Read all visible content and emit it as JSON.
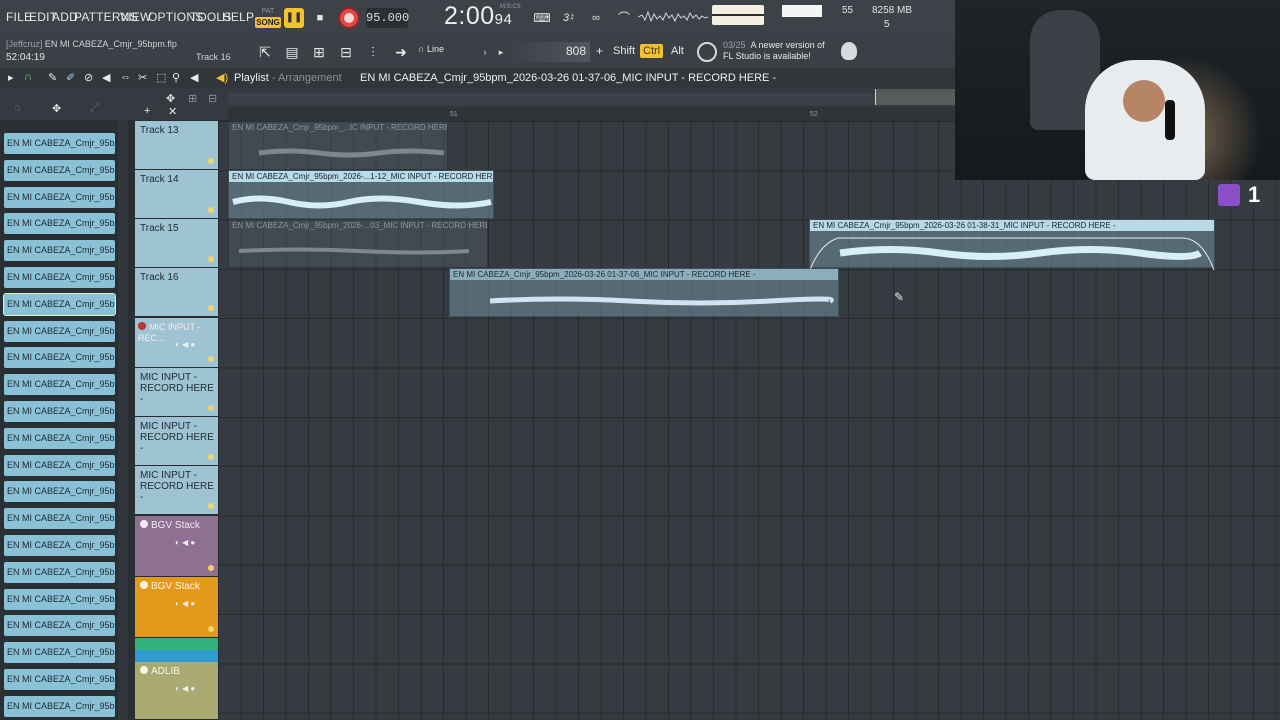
{
  "menu": [
    "FILE",
    "EDIT",
    "ADD",
    "PATTERNS",
    "VIEW",
    "OPTIONS",
    "TOOLS",
    "HELP"
  ],
  "mode": {
    "pat": "PAT",
    "song": "SONG"
  },
  "transport": {
    "tempo": "95.000",
    "time_main": "2:00",
    "time_frac": "94",
    "time_unit": "M:S:CS"
  },
  "monitor": {
    "cpu": "55",
    "memory": "8258 MB",
    "polyphony": "5"
  },
  "session": {
    "user": "[Jeffcruz]",
    "project_file": "EN MI CABEZA_Cmjr_95bpm.flp",
    "clock": "52:04:19",
    "track_label": "Track 16"
  },
  "toolbar": {
    "snap": "Line",
    "pattern_number": "808",
    "plus": "+",
    "shift": "Shift",
    "ctrl": "Ctrl",
    "alt": "Alt"
  },
  "notice": {
    "date": "03/25",
    "line1": "A newer version of",
    "line2": "FL Studio is available!"
  },
  "playlist": {
    "title": "Playlist",
    "section": "Arrangement",
    "current": "EN MI CABEZA_Cmjr_95bpm_2026-03-26 01-37-06_MIC INPUT - RECORD HERE -"
  },
  "ruler": {
    "mark1": "51",
    "mark2": "52"
  },
  "channels": [
    "EN MI CABEZA_Cmjr_95bp...",
    "EN MI CABEZA_Cmjr_95bp...",
    "EN MI CABEZA_Cmjr_95bp...",
    "EN MI CABEZA_Cmjr_95bp...",
    "EN MI CABEZA_Cmjr_95bp...",
    "EN MI CABEZA_Cmjr_95bp...",
    "EN MI CABEZA_Cmjr_95bp...",
    "EN MI CABEZA_Cmjr_95bp...",
    "EN MI CABEZA_Cmjr_95bp...",
    "EN MI CABEZA_Cmjr_95bp...",
    "EN MI CABEZA_Cmjr_95bp...",
    "EN MI CABEZA_Cmjr_95bp...",
    "EN MI CABEZA_Cmjr_95bp...",
    "EN MI CABEZA_Cmjr_95bp...",
    "EN MI CABEZA_Cmjr_95bp...",
    "EN MI CABEZA_Cmjr_95bp...",
    "EN MI CABEZA_Cmjr_95bp...",
    "EN MI CABEZA_Cmjr_95bp...",
    "EN MI CABEZA_Cmjr_95bp...",
    "EN MI CABEZA_Cmjr_95bp...",
    "EN MI CABEZA_Cmjr_95bp...",
    "EN MI CABEZA_Cmjr_95bp..."
  ],
  "tracks": [
    {
      "name": "Track 13"
    },
    {
      "name": "Track 14"
    },
    {
      "name": "Track 15"
    },
    {
      "name": "Track 16"
    },
    {
      "name": "MIC INPUT - REC..."
    },
    {
      "name": "MIC INPUT - RECORD HERE -"
    },
    {
      "name": "MIC INPUT - RECORD HERE -"
    },
    {
      "name": "MIC INPUT - RECORD HERE -"
    },
    {
      "name": "BGV Stack"
    },
    {
      "name": "BGV Stack"
    },
    {
      "name": "ADLIB"
    }
  ],
  "clips": [
    {
      "label": "EN MI CABEZA_Cmjr_95bpm_...IC INPUT - RECORD HERE -"
    },
    {
      "label": "EN MI CABEZA_Cmjr_95bpm_2026-...1-12_MIC INPUT - RECORD HERE -"
    },
    {
      "label": "EN MI CABEZA_Cmjr_95bpm_2026-...03_MIC INPUT - RECORD HERE -"
    },
    {
      "label": "EN MI CABEZA_Cmjr_95bpm_2026-03-26 01-38-31_MIC INPUT - RECORD HERE -"
    },
    {
      "label": "EN MI CABEZA_Cmjr_95bpm_2026-03-26 01-37-06_MIC INPUT - RECORD HERE -"
    }
  ],
  "stream": {
    "sub_count": "1"
  },
  "colors": {
    "accent": "#f1c232",
    "record": "#e64545",
    "clip": "#8bc1d6",
    "bgv_stack_1": "#8e7090",
    "bgv_stack_2": "#e39a1c",
    "adlib": "#a9aa72"
  }
}
